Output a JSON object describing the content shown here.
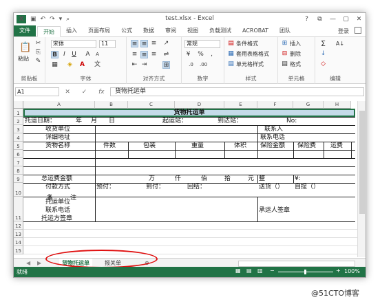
{
  "app": {
    "title": "test.xlsx - Excel",
    "quick_access_icons": [
      "excel-logo-icon",
      "save-icon",
      "undo-icon",
      "redo-icon",
      "customize-icon",
      "preview-icon"
    ],
    "window_controls": [
      "?",
      "⧉",
      "—",
      "▢",
      "✕"
    ]
  },
  "ribbon_tabs": [
    "文件",
    "开始",
    "插入",
    "页面布局",
    "公式",
    "数据",
    "审阅",
    "视图",
    "负载测试",
    "ACROBAT",
    "团队"
  ],
  "account": "登录",
  "ribbon": {
    "clipboard": {
      "paste": "粘贴",
      "label": "剪贴板"
    },
    "font": {
      "name": "宋体",
      "size": "11",
      "bold": "B",
      "italic": "I",
      "underline": "U",
      "grow": "A",
      "shrink": "A",
      "label": "字体"
    },
    "alignment": {
      "label": "对齐方式"
    },
    "number": {
      "format": "常规",
      "currency": "¥",
      "percent": "%",
      "comma": ",",
      "label": "数字"
    },
    "styles": {
      "conditional": "条件格式",
      "table": "套用表格格式",
      "cell": "单元格样式",
      "label": "样式"
    },
    "cells": {
      "insert": "插入",
      "delete": "删除",
      "format": "格式",
      "label": "单元格"
    },
    "editing": {
      "sum": "Σ",
      "fill": "↓",
      "clear": "◇",
      "sort": "A↓",
      "label": "编辑"
    }
  },
  "namebox": "A1",
  "formula": "货物托运单",
  "columns": [
    "A",
    "B",
    "C",
    "D",
    "E",
    "F",
    "G",
    "H"
  ],
  "rows": [
    "1",
    "2",
    "3",
    "4",
    "5",
    "6",
    "7",
    "8",
    "9",
    "10",
    "11",
    "12",
    "13",
    "14",
    "15"
  ],
  "sheet": {
    "title": "货物托运单",
    "r2": {
      "a": "托运日期：",
      "y": "年",
      "m": "月",
      "d": "日",
      "from": "起运站：",
      "to": "到达站：",
      "no": "No:"
    },
    "r3": {
      "a": "收货单位",
      "f": "联系人"
    },
    "r4": {
      "a": "详细地址",
      "f": "联系电话"
    },
    "r5": {
      "a": "货物名称",
      "b": "件数",
      "c": "包装",
      "d": "重量",
      "e": "体积",
      "f": "保险金额",
      "g": "保险费",
      "h": "运费"
    },
    "r8": {
      "a": "总运费金额",
      "wan": "万",
      "qian": "仟",
      "bai": "佰",
      "shi": "拾",
      "yuan": "元",
      "zheng": "整",
      "yen": "¥:"
    },
    "r9": {
      "a": "付款方式",
      "b": "预付：",
      "c": "到付：",
      "d": "回结：",
      "f": "送货（）",
      "g": "自提（）"
    },
    "r10": {
      "a": "备",
      "a2": "注"
    },
    "r11": {
      "a1": "托运单位",
      "a2": "联系电话",
      "a3": "托运方签章",
      "f": "承运人签章"
    }
  },
  "sheet_tabs": [
    {
      "label": "货物托运单",
      "active": true
    },
    {
      "label": "报关单",
      "active": false
    }
  ],
  "status": {
    "ready": "就绪",
    "zoom": "100%"
  },
  "watermark": "@51CTO博客",
  "colors": {
    "excel_green": "#217346",
    "annotation_red": "#e01010",
    "title_row_fill": "#c5dbe9"
  }
}
